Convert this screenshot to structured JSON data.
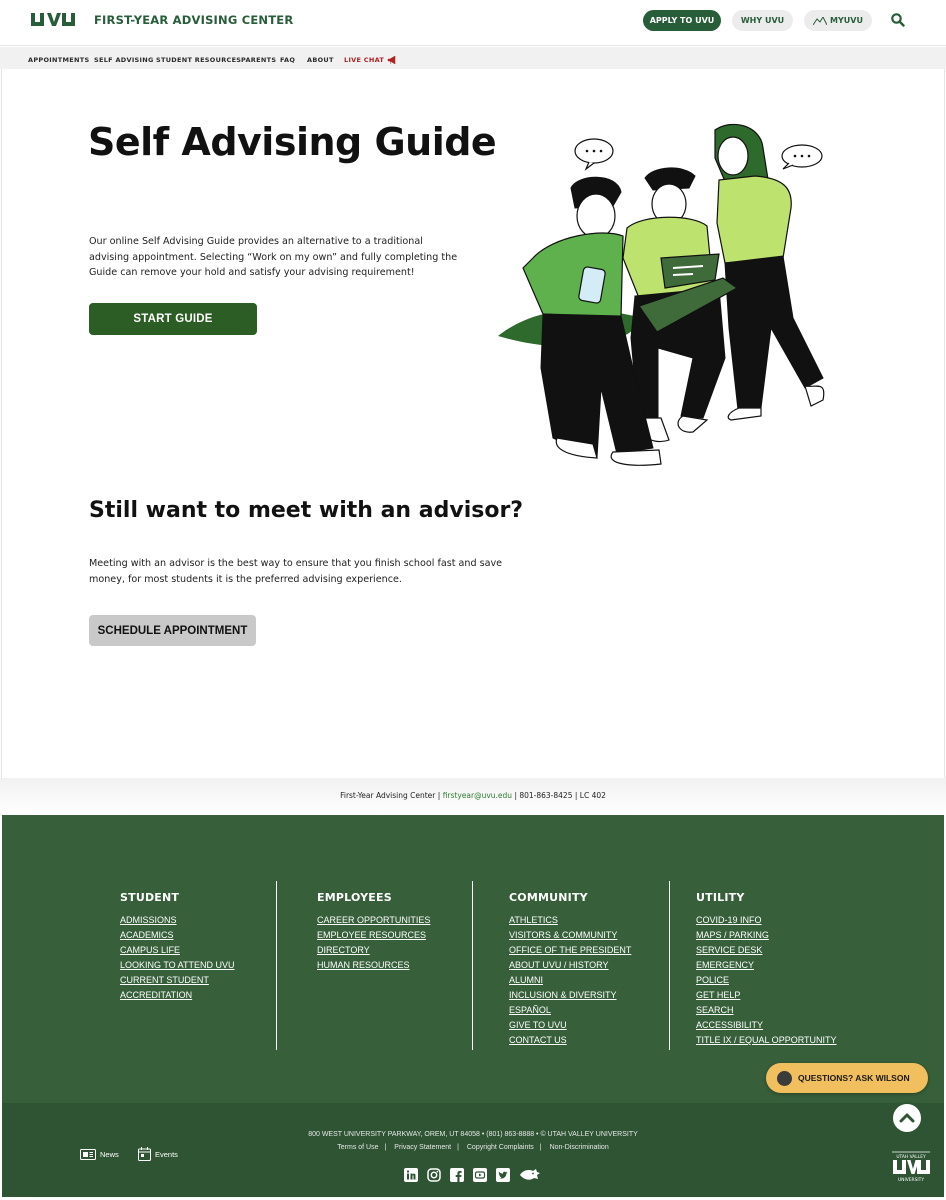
{
  "header": {
    "site_name": "FIRST-YEAR ADVISING CENTER",
    "apply_label": "APPLY TO UVU",
    "why_label": "WHY UVU",
    "myuvu_label": "MYUVU",
    "search_icon": "search-icon"
  },
  "subnav": {
    "items": [
      "APPOINTMENTS",
      "SELF ADVISING",
      "STUDENT RESOURCES",
      "PARENTS",
      "FAQ",
      "ABOUT"
    ],
    "live_chat": "LIVE CHAT"
  },
  "hero": {
    "title": "Self Advising Guide",
    "description": "Our online Self Advising Guide provides an alternative to a traditional advising appointment. Selecting “Work on my own” and fully completing the Guide can remove your hold and satisfy your advising requirement!",
    "button": "START GUIDE"
  },
  "advisor": {
    "title": "Still want to meet with an advisor?",
    "description": "Meeting with an advisor is the best way to ensure that you finish school fast and save money, for most students it is the preferred advising experience.",
    "button": "SCHEDULE APPOINTMENT"
  },
  "contact": {
    "name": "First-Year Advising Center |",
    "email": "firstyear@uvu.edu",
    "rest": "| 801-863-8425 | LC 402"
  },
  "footer": {
    "columns": [
      {
        "heading": "STUDENT",
        "links": [
          "ADMISSIONS",
          "ACADEMICS",
          "CAMPUS LIFE",
          "LOOKING TO ATTEND UVU",
          "CURRENT STUDENT",
          "ACCREDITATION"
        ]
      },
      {
        "heading": "EMPLOYEES",
        "links": [
          "CAREER OPPORTUNITIES",
          "EMPLOYEE RESOURCES",
          "DIRECTORY",
          "HUMAN RESOURCES"
        ]
      },
      {
        "heading": "COMMUNITY",
        "links": [
          "ATHLETICS",
          "VISITORS & COMMUNITY",
          "OFFICE OF THE PRESIDENT",
          "ABOUT UVU / HISTORY",
          "ALUMNI",
          "INCLUSION & DIVERSITY",
          "ESPAÑOL",
          "GIVE TO UVU",
          "CONTACT US"
        ]
      },
      {
        "heading": "UTILITY",
        "links": [
          "COVID-19 INFO",
          "MAPS / PARKING",
          "SERVICE DESK",
          "EMERGENCY",
          "POLICE",
          "GET HELP",
          "SEARCH",
          "ACCESSIBILITY",
          "TITLE IX / EQUAL OPPORTUNITY"
        ]
      }
    ],
    "wilson": "QUESTIONS? ASK WILSON",
    "address": "800 WEST UNIVERSITY PARKWAY, OREM, UT 84058  •  (801) 863-8888  •  © UTAH VALLEY UNIVERSITY",
    "legal": [
      "Terms of Use",
      "Privacy Statement",
      "Copyright Complaints",
      "Non-Discrimination"
    ],
    "news": "News",
    "events": "Events",
    "socials": [
      "linkedin-icon",
      "instagram-icon",
      "facebook-icon",
      "youtube-icon",
      "twitter-icon",
      "wolverine-icon"
    ]
  },
  "colors": {
    "brand_green": "#275d38",
    "footer_green": "#365f3a",
    "button_green": "#2b5d24",
    "wilson_yellow": "#f2bf5e",
    "live_chat_red": "#b22222"
  }
}
